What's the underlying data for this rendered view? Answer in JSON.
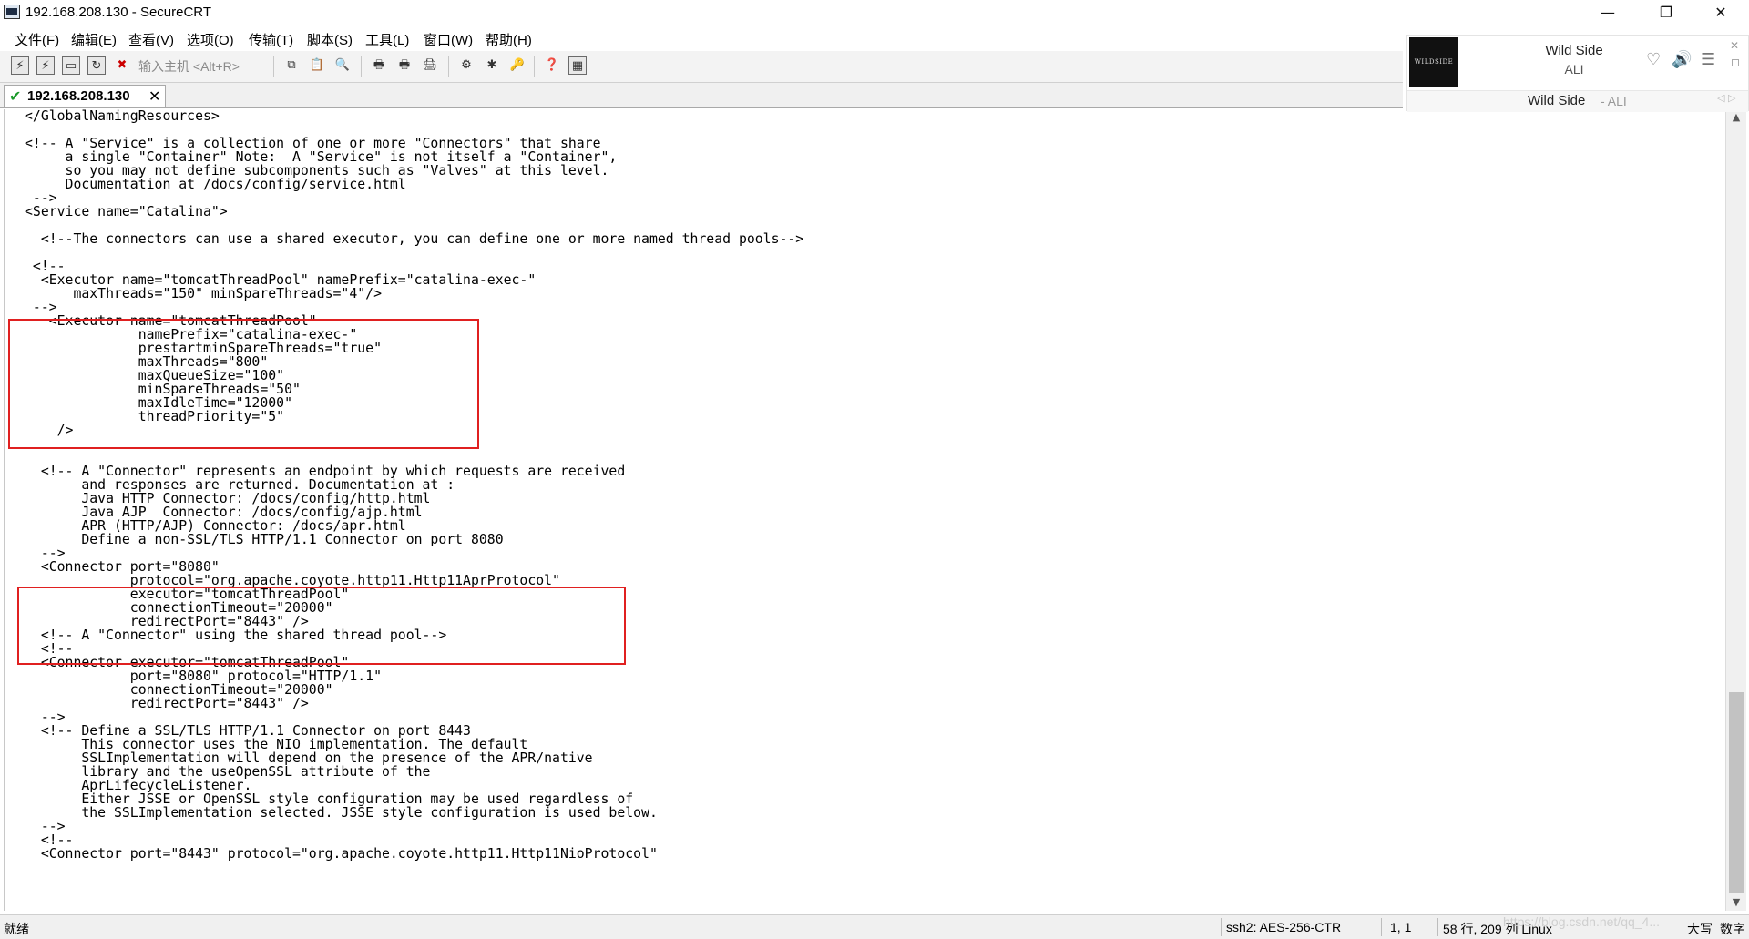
{
  "window": {
    "title": "192.168.208.130 - SecureCRT"
  },
  "menu": [
    "文件(F)",
    "编辑(E)",
    "查看(V)",
    "选项(O)",
    "传输(T)",
    "脚本(S)",
    "工具(L)",
    "窗口(W)",
    "帮助(H)"
  ],
  "toolbar": {
    "quick_connect_placeholder": "输入主机 <Alt+R>"
  },
  "tab": {
    "label": "192.168.208.130"
  },
  "terminal": {
    "text": "</GlobalNamingResources>\n\n<!-- A \"Service\" is a collection of one or more \"Connectors\" that share\n     a single \"Container\" Note:  A \"Service\" is not itself a \"Container\",\n     so you may not define subcomponents such as \"Valves\" at this level.\n     Documentation at /docs/config/service.html\n -->\n<Service name=\"Catalina\">\n\n  <!--The connectors can use a shared executor, you can define one or more named thread pools-->\n\n <!--\n  <Executor name=\"tomcatThreadPool\" namePrefix=\"catalina-exec-\"\n      maxThreads=\"150\" minSpareThreads=\"4\"/>\n -->\n   <Executor name=\"tomcatThreadPool\"\n              namePrefix=\"catalina-exec-\"\n              prestartminSpareThreads=\"true\"\n              maxThreads=\"800\"\n              maxQueueSize=\"100\"\n              minSpareThreads=\"50\"\n              maxIdleTime=\"12000\"\n              threadPriority=\"5\"\n    />\n\n\n  <!-- A \"Connector\" represents an endpoint by which requests are received\n       and responses are returned. Documentation at :\n       Java HTTP Connector: /docs/config/http.html\n       Java AJP  Connector: /docs/config/ajp.html\n       APR (HTTP/AJP) Connector: /docs/apr.html\n       Define a non-SSL/TLS HTTP/1.1 Connector on port 8080\n  -->\n  <Connector port=\"8080\"\n             protocol=\"org.apache.coyote.http11.Http11AprProtocol\"\n             executor=\"tomcatThreadPool\"\n             connectionTimeout=\"20000\"\n             redirectPort=\"8443\" />\n  <!-- A \"Connector\" using the shared thread pool-->\n  <!--\n  <Connector executor=\"tomcatThreadPool\"\n             port=\"8080\" protocol=\"HTTP/1.1\"\n             connectionTimeout=\"20000\"\n             redirectPort=\"8443\" />\n  -->\n  <!-- Define a SSL/TLS HTTP/1.1 Connector on port 8443\n       This connector uses the NIO implementation. The default\n       SSLImplementation will depend on the presence of the APR/native\n       library and the useOpenSSL attribute of the\n       AprLifecycleListener.\n       Either JSSE or OpenSSL style configuration may be used regardless of\n       the SSLImplementation selected. JSSE style configuration is used below.\n  -->\n  <!--\n  <Connector port=\"8443\" protocol=\"org.apache.coyote.http11.Http11NioProtocol\""
  },
  "status": {
    "ready": "就绪",
    "encryption": "ssh2: AES-256-CTR",
    "cursor": "1,   1",
    "size": "58 行, 209 列 Linux",
    "caps": "大写",
    "num": "数字",
    "watermark": "https://blog.csdn.net/qq_4..."
  },
  "music": {
    "album_art_text": "WILDSIDE",
    "title": "Wild Side",
    "artist": "ALI",
    "line_song": "Wild Side",
    "line_artist": "- ALI"
  },
  "colors": {
    "highlight": "#e02020",
    "tab_check": "#1a9a2a"
  }
}
